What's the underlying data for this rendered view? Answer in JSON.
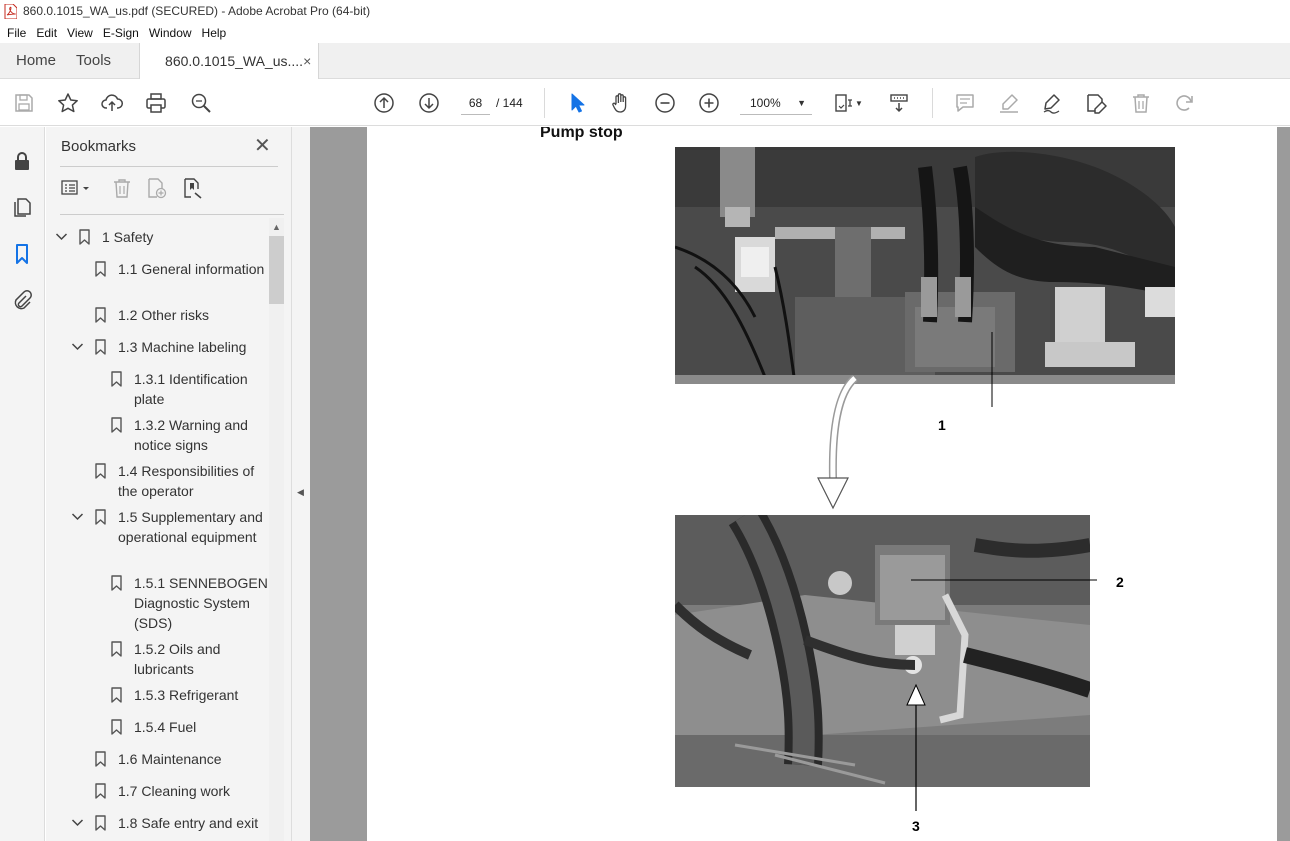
{
  "window": {
    "title": "860.0.1015_WA_us.pdf (SECURED) - Adobe Acrobat Pro (64-bit)"
  },
  "menu": [
    "File",
    "Edit",
    "View",
    "E-Sign",
    "Window",
    "Help"
  ],
  "tabs": {
    "home": "Home",
    "tools": "Tools",
    "document": "860.0.1015_WA_us....",
    "close": "×"
  },
  "toolbar": {
    "page_current": "68",
    "page_total": "/ 144",
    "zoom": "100%"
  },
  "bookmarks": {
    "title": "Bookmarks",
    "close": "✕",
    "items": [
      {
        "label": "1 Safety",
        "level": 0,
        "expanded": true
      },
      {
        "label": "1.1 General information",
        "level": 1
      },
      {
        "label": "1.2 Other risks",
        "level": 1
      },
      {
        "label": "1.3 Machine labeling",
        "level": 1,
        "expanded": true
      },
      {
        "label": "1.3.1 Identification plate",
        "level": 2
      },
      {
        "label": "1.3.2 Warning and notice signs",
        "level": 2
      },
      {
        "label": "1.4 Responsibilities of the operator",
        "level": 1
      },
      {
        "label": "1.5 Supplementary and operational equipment",
        "level": 1,
        "expanded": true
      },
      {
        "label": "1.5.1 SENNEBOGEN Diagnostic System (SDS)",
        "level": 2
      },
      {
        "label": "1.5.2 Oils and lubricants",
        "level": 2
      },
      {
        "label": "1.5.3 Refrigerant",
        "level": 2
      },
      {
        "label": "1.5.4 Fuel",
        "level": 2
      },
      {
        "label": "1.6 Maintenance",
        "level": 1
      },
      {
        "label": "1.7 Cleaning work",
        "level": 1
      },
      {
        "label": "1.8 Safe entry and exit",
        "level": 1,
        "expanded": true
      }
    ]
  },
  "document": {
    "heading": "Pump stop",
    "callouts": [
      "1",
      "2",
      "3"
    ]
  },
  "icons": {
    "toolbar": [
      "save-icon",
      "star-icon",
      "upload-icon",
      "print-icon",
      "zoom-search-icon",
      "page-up-icon",
      "page-down-icon",
      "select-cursor-icon",
      "hand-icon",
      "zoom-out-icon",
      "zoom-in-icon",
      "fit-page-icon",
      "scroll-mode-icon",
      "comment-icon",
      "highlight-icon",
      "sign-icon",
      "edit-icon",
      "delete-icon",
      "redo-icon"
    ],
    "rail": [
      "lock-icon",
      "pages-icon",
      "bookmark-icon",
      "attachment-icon"
    ]
  },
  "colors": {
    "accent": "#1473e6",
    "viewport_bg": "#9b9b9b"
  }
}
